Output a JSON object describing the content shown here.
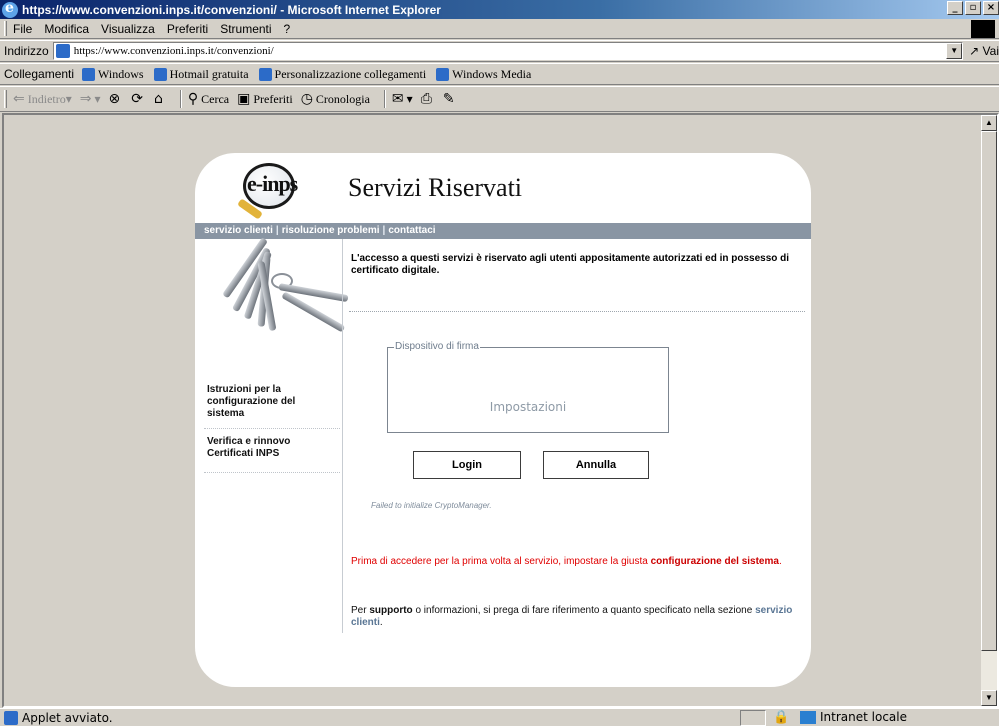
{
  "window": {
    "title": "https://www.convenzioni.inps.it/convenzioni/ - Microsoft Internet Explorer",
    "controls": [
      "_",
      "▫",
      "×"
    ]
  },
  "menu": [
    "File",
    "Modifica",
    "Visualizza",
    "Preferiti",
    "Strumenti",
    "?"
  ],
  "address": {
    "label": "Indirizzo",
    "url": "https://www.convenzioni.inps.it/convenzioni/",
    "go_label": "Vai"
  },
  "links": {
    "label": "Collegamenti",
    "items": [
      "Windows",
      "Hotmail gratuita",
      "Personalizzazione collegamenti",
      "Windows Media"
    ]
  },
  "toolbar": {
    "back": "Indietro",
    "search": "Cerca",
    "favorites": "Preferiti",
    "history": "Cronologia"
  },
  "page": {
    "logo_text": "e-inps",
    "title": "Servizi Riservati",
    "nav": [
      "servizio clienti",
      "risoluzione problemi",
      "contattaci"
    ],
    "side_links": [
      "Istruzioni per la configurazione del sistema",
      "Verifica e rinnovo Certificati INPS"
    ],
    "intro": "L'accesso a questi servizi è riservato agli utenti appositamente autorizzati ed in possesso di certificato digitale.",
    "device_legend": "Dispositivo di firma",
    "settings_label": "Impostazioni",
    "login_label": "Login",
    "cancel_label": "Annulla",
    "error_message": "Failed to initialize CryptoManager.",
    "warning_pre": "Prima di accedere per la prima volta al servizio, impostare la giusta ",
    "warning_link": "configurazione del sistema",
    "warning_post": ".",
    "support_pre": "Per ",
    "support_bold": "supporto",
    "support_mid": " o informazioni, si prega di fare riferimento a quanto specificato nella sezione ",
    "support_link": "servizio clienti",
    "support_post": "."
  },
  "status": {
    "text": "Applet avviato.",
    "zone": "Intranet locale"
  }
}
